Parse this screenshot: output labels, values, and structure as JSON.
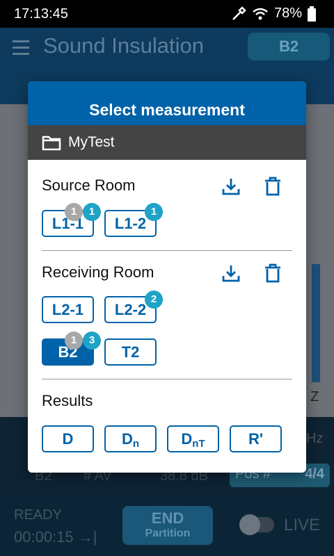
{
  "status_bar": {
    "time": "17:13:45",
    "battery": "78%"
  },
  "app": {
    "title": "Sound Insulation",
    "chip": "B2",
    "bottom_row_1": {
      "label": "Hz"
    },
    "bottom_row_2": {
      "name": "B2",
      "mode": "# AV",
      "level": "38.8 dB"
    },
    "pos": {
      "label": "Pos #",
      "value": "4/4"
    },
    "footer": {
      "status": "READY",
      "timer": "00:00:15 →|",
      "end_label": "END",
      "end_sub": "Partition",
      "live_label": "LIVE"
    },
    "axis_z": "Z"
  },
  "modal": {
    "title": "Select measurement",
    "folder": "MyTest",
    "source_room": {
      "title": "Source Room",
      "buttons": [
        {
          "label": "L1-1",
          "badges": [
            "1",
            "1"
          ]
        },
        {
          "label": "L1-2",
          "badges": [
            "1"
          ]
        }
      ]
    },
    "receiving_room": {
      "title": "Receiving Room",
      "buttons": [
        {
          "label": "L2-1",
          "badges": []
        },
        {
          "label": "L2-2",
          "badges": [
            "2"
          ]
        },
        {
          "label": "B2",
          "badges": [
            "1",
            "3"
          ],
          "selected": true
        },
        {
          "label": "T2",
          "badges": []
        }
      ]
    },
    "results": {
      "title": "Results",
      "buttons": [
        {
          "label": "D",
          "sub": ""
        },
        {
          "label": "D",
          "sub": "n"
        },
        {
          "label": "D",
          "sub": "nT"
        },
        {
          "label": "R'",
          "sub": ""
        }
      ]
    }
  },
  "colors": {
    "accent": "#0062a8",
    "badge_teal": "#1fa3c8",
    "badge_grey": "#a8a8a8"
  }
}
